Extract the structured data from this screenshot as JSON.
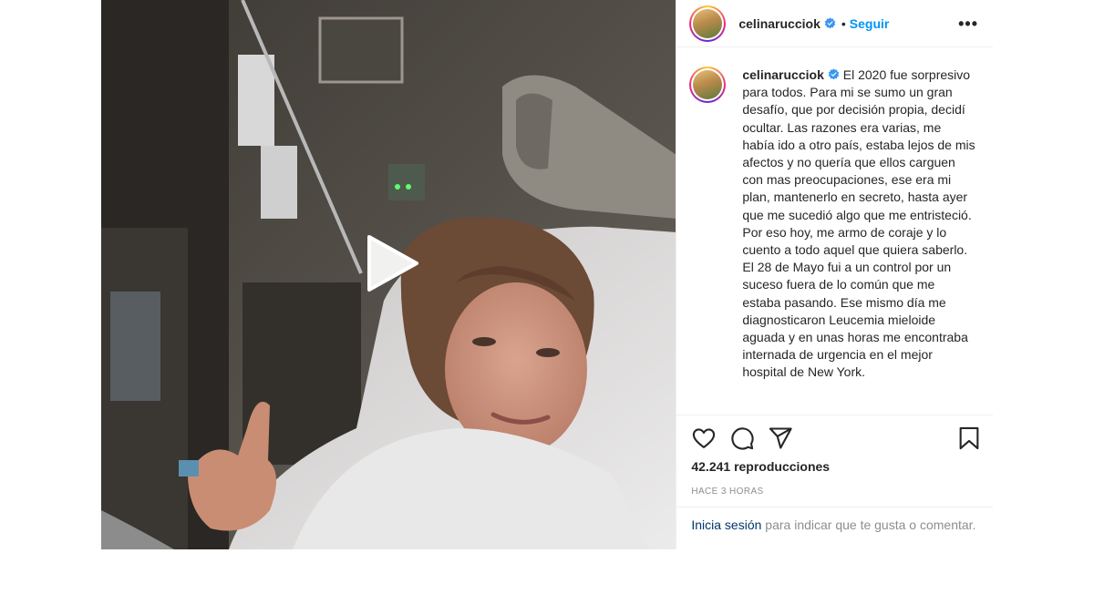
{
  "post": {
    "username": "celinarucciok",
    "follow_label": "Seguir",
    "more_label": "•••",
    "caption": "El 2020 fue sorpresivo para todos. Para mi se sumo un gran desafío, que por decisión propia, decidí ocultar. Las razones era varias, me había ido a otro país, estaba lejos de mis afectos y no quería que ellos carguen con mas preocupaciones, ese era mi plan, mantenerlo en secreto, hasta ayer que me sucedió algo que me entristeció. Por eso hoy, me armo de coraje y lo cuento a todo aquel que quiera saberlo.\nEl 28 de Mayo fui a un control por un suceso fuera de lo común que me estaba pasando. Ese mismo día me diagnosticaron Leucemia mieloide aguada y en unas horas me encontraba internada de urgencia en el mejor hospital de New York.",
    "views": "42.241 reproducciones",
    "timestamp": "HACE 3 HORAS",
    "login_link": "Inicia sesión",
    "login_text": " para indicar que te gusta o comentar."
  },
  "icons": {
    "play": "play-icon",
    "like": "heart-icon",
    "comment": "comment-icon",
    "share": "send-icon",
    "save": "bookmark-icon",
    "verified": "verified-badge-icon"
  },
  "colors": {
    "link": "#0095f6",
    "muted": "#8e8e8e",
    "text": "#262626",
    "login": "#00376b"
  }
}
